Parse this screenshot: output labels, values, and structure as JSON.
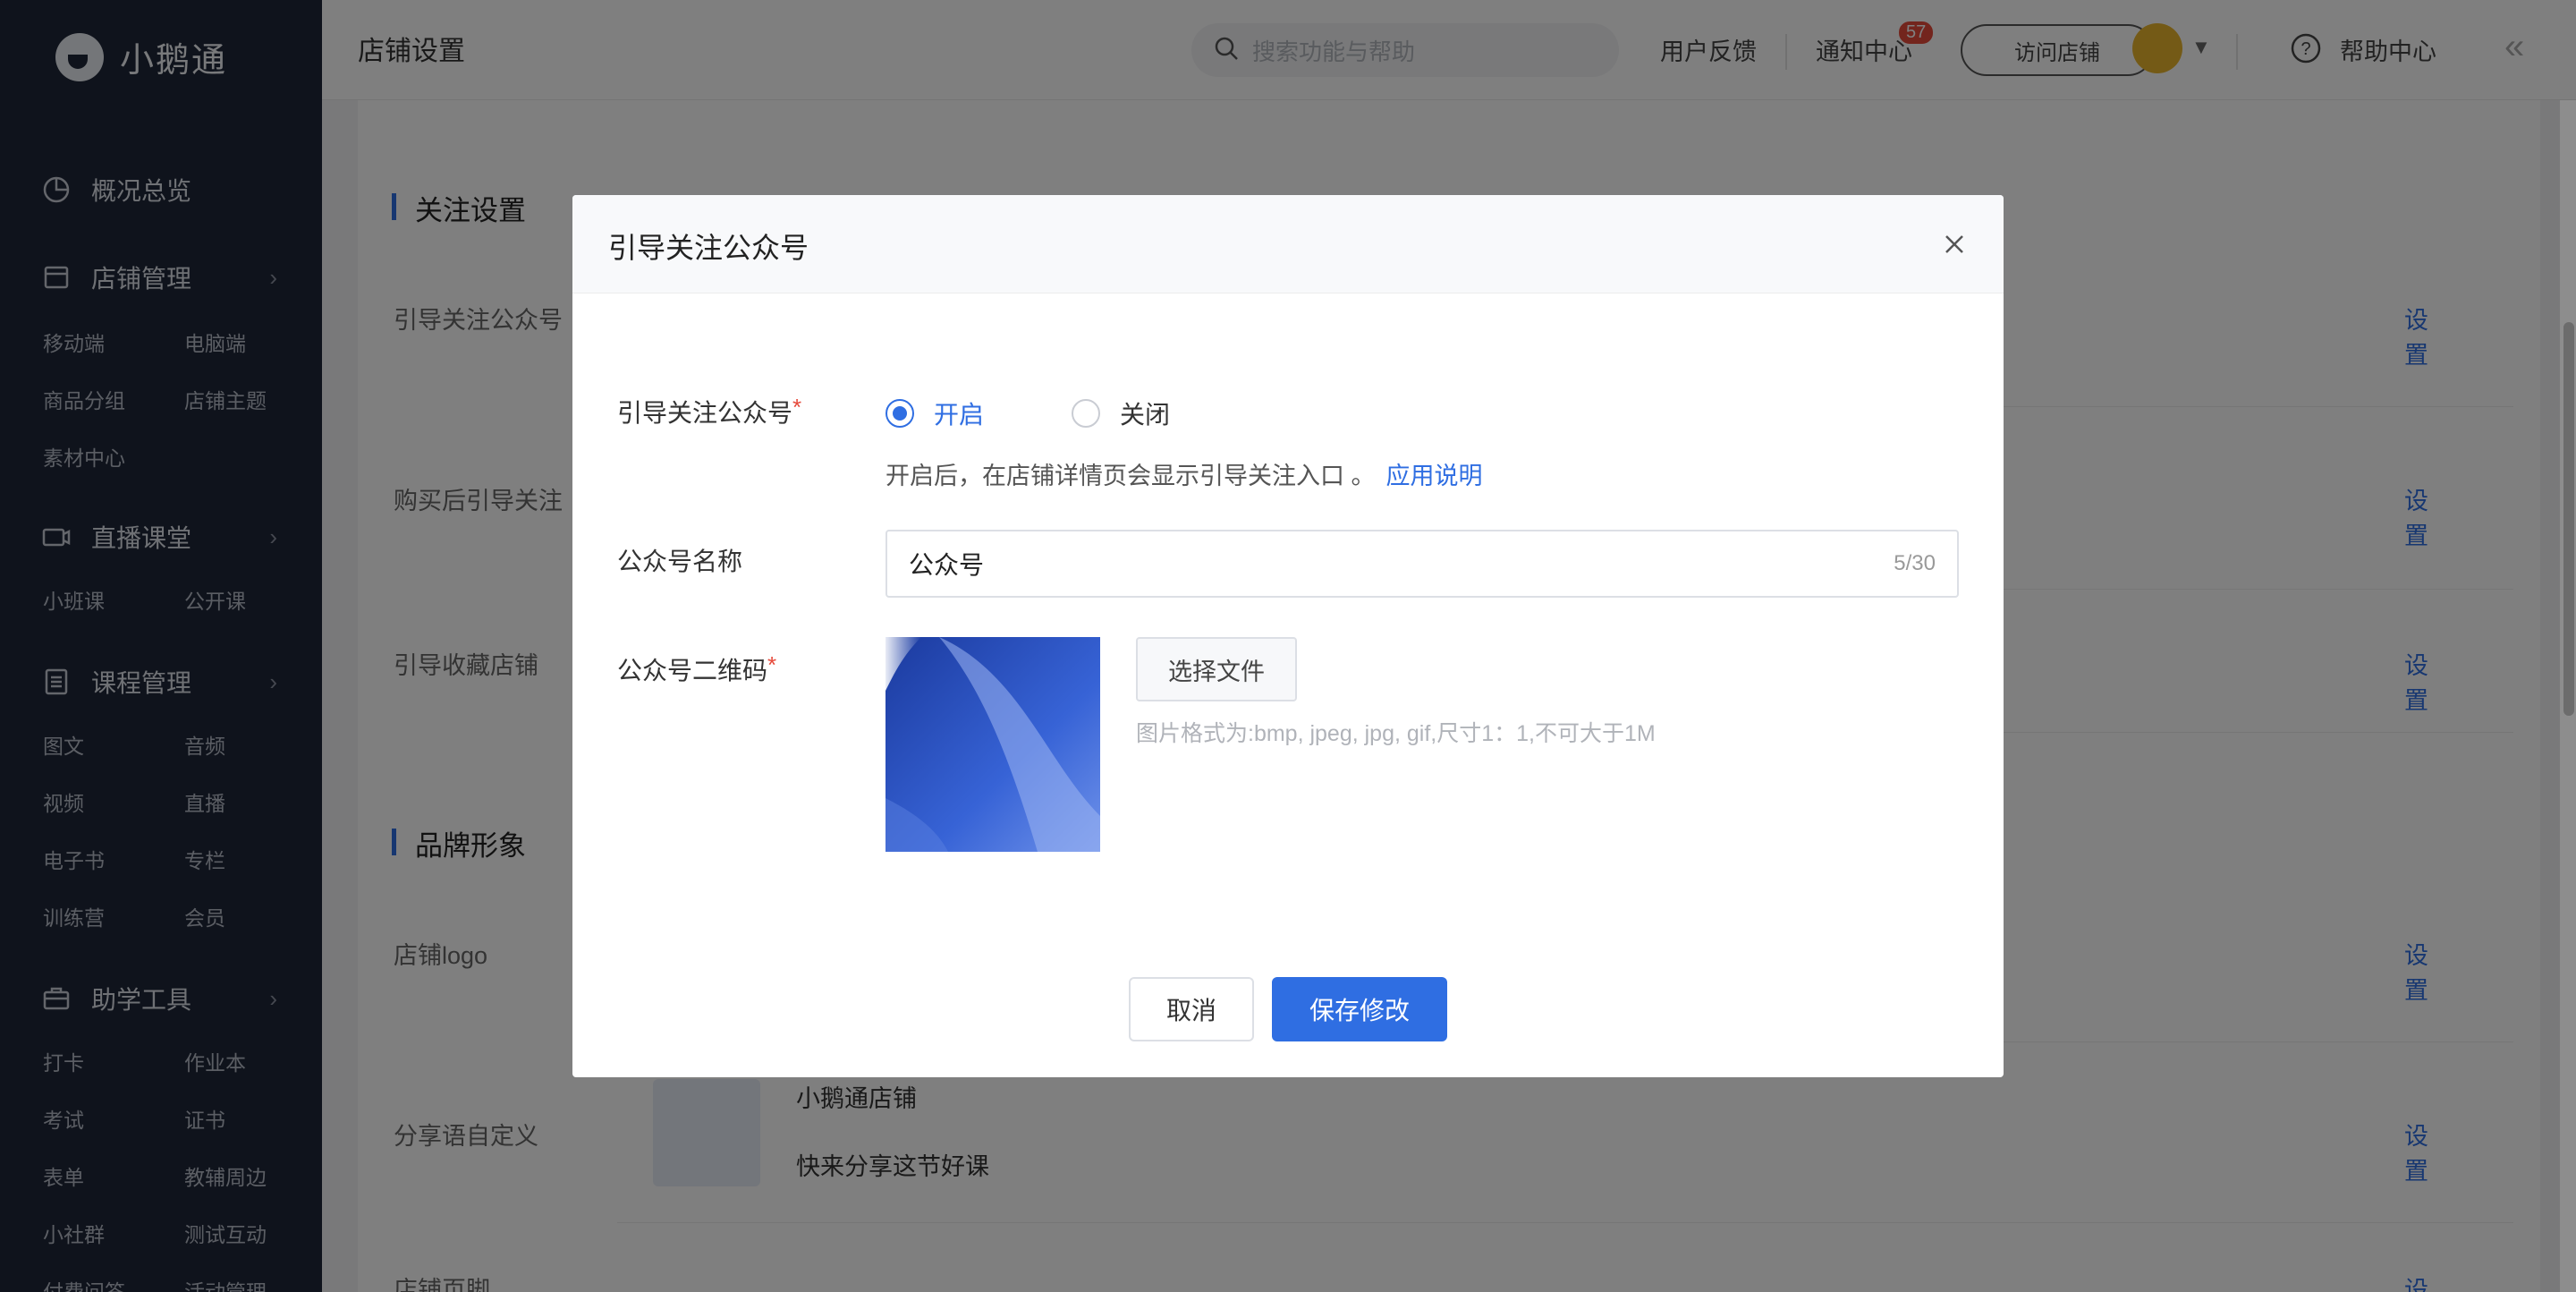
{
  "app": {
    "logo_text": "小鹅通"
  },
  "sidebar": {
    "overview": "概况总览",
    "groups": [
      {
        "label": "店铺管理",
        "icon": "shop-icon",
        "items": [
          "移动端",
          "电脑端",
          "商品分组",
          "店铺主题",
          "素材中心"
        ]
      },
      {
        "label": "直播课堂",
        "icon": "video-icon",
        "items": [
          "小班课",
          "公开课"
        ]
      },
      {
        "label": "课程管理",
        "icon": "document-icon",
        "items": [
          "图文",
          "音频",
          "视频",
          "直播",
          "电子书",
          "专栏",
          "训练营",
          "会员"
        ]
      },
      {
        "label": "助学工具",
        "icon": "briefcase-icon",
        "items": [
          "打卡",
          "作业本",
          "考试",
          "证书",
          "表单",
          "教辅周边",
          "小社群",
          "测试互动",
          "付费问答",
          "活动管理"
        ]
      }
    ]
  },
  "topbar": {
    "page_title": "店铺设置",
    "search_placeholder": "搜索功能与帮助",
    "feedback": "用户反馈",
    "notifications": "通知中心",
    "notification_count": "57",
    "visit_store": "访问店铺",
    "help": "帮助中心"
  },
  "content": {
    "section_follow": "关注设置",
    "rows_follow": [
      {
        "label": "引导关注公众号",
        "action": "设置"
      },
      {
        "label": "购买后引导关注",
        "action": "设置"
      },
      {
        "label": "引导收藏店铺",
        "action": "设置"
      }
    ],
    "section_brand": "品牌形象",
    "rows_brand": [
      {
        "label": "店铺logo",
        "action": "设置"
      },
      {
        "label": "分享语自定义",
        "action": "设置"
      },
      {
        "label": "店铺页脚",
        "action": "设置"
      }
    ],
    "share_title": "小鹅通店铺",
    "share_desc": "快来分享这节好课"
  },
  "modal": {
    "title": "引导关注公众号",
    "field_follow_label": "引导关注公众号",
    "radio_on": "开启",
    "radio_off": "关闭",
    "selected": "开启",
    "hint_text": "开启后，在店铺详情页会显示引导关注入口 。",
    "hint_link": "应用说明",
    "field_name_label": "公众号名称",
    "name_value": "公众号",
    "name_counter": "5/30",
    "field_qr_label": "公众号二维码",
    "choose_file": "选择文件",
    "file_hint": "图片格式为:bmp, jpeg, jpg, gif,尺寸1：1,不可大于1M",
    "cancel": "取消",
    "save": "保存修改"
  },
  "colors": {
    "accent": "#2f6ee2",
    "sidebar_bg": "#1f2738",
    "required": "#e64a3b"
  }
}
